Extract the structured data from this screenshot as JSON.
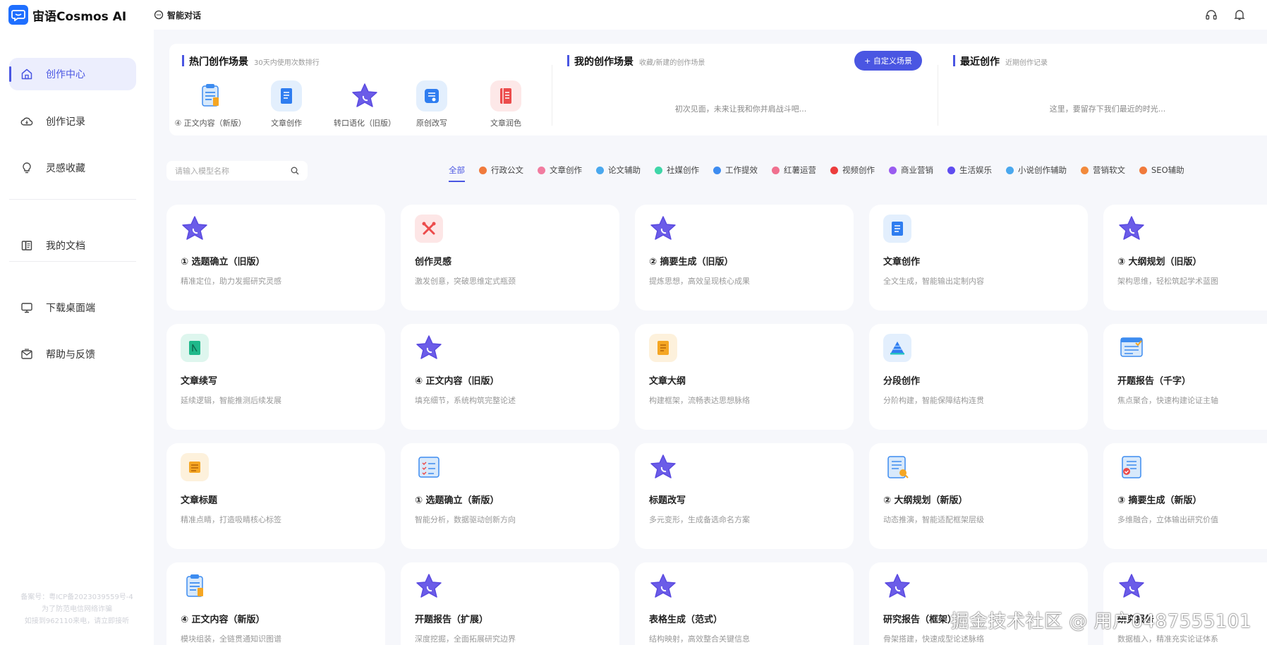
{
  "header": {
    "logo_text": "宙语Cosmos AI",
    "nav_label": "智能对话"
  },
  "sidebar": {
    "items": [
      {
        "label": "创作中心",
        "icon": "home-icon"
      },
      {
        "label": "创作记录",
        "icon": "cloud-icon"
      },
      {
        "label": "灵感收藏",
        "icon": "lightbulb-icon"
      },
      {
        "label": "我的文档",
        "icon": "document-icon"
      },
      {
        "label": "下载桌面端",
        "icon": "monitor-icon"
      },
      {
        "label": "帮助与反馈",
        "icon": "mail-icon"
      }
    ],
    "footer_lines": [
      "备案号：粤ICP备2023039559号-4",
      "为了防范电信网络诈骗",
      "如接到962110来电，请立即接听"
    ]
  },
  "hot": {
    "title": "热门创作场景",
    "subtitle": "30天内使用次数排行",
    "items": [
      {
        "label": "④ 正文内容（新版）",
        "icon": "clipboard-icon"
      },
      {
        "label": "文章创作",
        "icon": "notebook-icon"
      },
      {
        "label": "转口语化（旧版）",
        "icon": "star-icon"
      },
      {
        "label": "原创改写",
        "icon": "card-icon"
      },
      {
        "label": "文章润色",
        "icon": "book-icon"
      }
    ]
  },
  "mine": {
    "title": "我的创作场景",
    "subtitle": "收藏/新建的创作场景",
    "button": "+ 自定义场景",
    "empty": "初次见面，未来让我和你并肩战斗吧..."
  },
  "recent": {
    "title": "最近创作",
    "subtitle": "近期创作记录",
    "empty": "这里，要留存下我们最近的时光..."
  },
  "search": {
    "placeholder": "请输入模型名称"
  },
  "tabs": [
    {
      "label": "全部",
      "color": ""
    },
    {
      "label": "行政公文",
      "color": "#f07a3c"
    },
    {
      "label": "文章创作",
      "color": "#f17ca0"
    },
    {
      "label": "论文辅助",
      "color": "#4aa8ee"
    },
    {
      "label": "社媒创作",
      "color": "#3fd6a8"
    },
    {
      "label": "工作提效",
      "color": "#3d8cf0"
    },
    {
      "label": "红薯运营",
      "color": "#f0708f"
    },
    {
      "label": "视频创作",
      "color": "#ec3d3d"
    },
    {
      "label": "商业营销",
      "color": "#9a5cf0"
    },
    {
      "label": "生活娱乐",
      "color": "#5f4df0"
    },
    {
      "label": "小说创作辅助",
      "color": "#4aa8ee"
    },
    {
      "label": "营销软文",
      "color": "#f28a3c"
    },
    {
      "label": "SEO辅助",
      "color": "#f07a3c"
    }
  ],
  "cards": [
    {
      "title": "① 选题确立（旧版）",
      "desc": "精准定位，助力发掘研究灵感",
      "icon": "star-icon"
    },
    {
      "title": "创作灵感",
      "desc": "激发创意，突破思维定式瓶颈",
      "icon": "cross-tools-icon"
    },
    {
      "title": "② 摘要生成（旧版）",
      "desc": "提炼思想，高效呈现核心成果",
      "icon": "star-icon"
    },
    {
      "title": "文章创作",
      "desc": "全文生成，智能输出定制内容",
      "icon": "notebook-icon"
    },
    {
      "title": "③ 大纲规划（旧版）",
      "desc": "架构思维，轻松筑起学术蓝图",
      "icon": "star-icon"
    },
    {
      "title": "文章续写",
      "desc": "延续逻辑，智能推测后续发展",
      "icon": "green-book-icon"
    },
    {
      "title": "④ 正文内容（旧版）",
      "desc": "填充细节，系统构筑完整论述",
      "icon": "star-icon"
    },
    {
      "title": "文章大纲",
      "desc": "构建框架，流畅表达思想脉络",
      "icon": "orange-doc-icon"
    },
    {
      "title": "分段创作",
      "desc": "分阶构建，智能保障结构连贯",
      "icon": "pyramid-icon"
    },
    {
      "title": "开题报告（千字）",
      "desc": "焦点聚合，快速构建论证主轴",
      "icon": "report-icon"
    },
    {
      "title": "文章标题",
      "desc": "精准点睛，打造吸睛核心标签",
      "icon": "title-icon"
    },
    {
      "title": "① 选题确立（新版）",
      "desc": "智能分析，数据驱动创新方向",
      "icon": "checklist-icon"
    },
    {
      "title": "标题改写",
      "desc": "多元变形，生成备选命名方案",
      "icon": "star-icon"
    },
    {
      "title": "② 大纲规划（新版）",
      "desc": "动态推演，智能适配框架层级",
      "icon": "outline-icon"
    },
    {
      "title": "③ 摘要生成（新版）",
      "desc": "多维融合，立体输出研究价值",
      "icon": "badge-doc-icon"
    },
    {
      "title": "④ 正文内容（新版）",
      "desc": "模块组装，全链贯通知识图谱",
      "icon": "clipboard-icon"
    },
    {
      "title": "开题报告（扩展）",
      "desc": "深度挖掘，全面拓展研究边界",
      "icon": "star-icon"
    },
    {
      "title": "表格生成（范式）",
      "desc": "结构映射，高效整合关键信息",
      "icon": "star-icon"
    },
    {
      "title": "研究报告（框架）",
      "desc": "骨架搭建，快速成型论述脉络",
      "icon": "star-icon"
    },
    {
      "title": "研究报告",
      "desc": "数据植入，精准充实论证体系",
      "icon": "star-icon"
    }
  ],
  "watermark": "掘金技术社区 @ 用户0487555101",
  "colors": {
    "accent": "#4a56e2",
    "brand": "#1f6fff"
  }
}
